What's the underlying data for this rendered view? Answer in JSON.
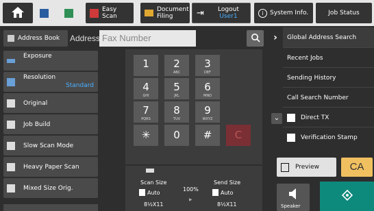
{
  "top_bar": {
    "easy_scan": "Easy Scan",
    "easy_scan_line1": "Easy",
    "easy_scan_line2": "Scan",
    "doc_filing_line1": "Document",
    "doc_filing_line2": "Filing",
    "logout_line1": "Logout",
    "logout_user": "User1",
    "system_info": "System Info.",
    "job_status": "Job Status"
  },
  "address": {
    "address_book": "Address Book",
    "address_label": "Address",
    "fax_placeholder": "Fax Number"
  },
  "left_items": [
    {
      "label": "Exposure",
      "value": ""
    },
    {
      "label": "Resolution",
      "value": "Standard"
    },
    {
      "label": "Original",
      "value": ""
    },
    {
      "label": "Job Build",
      "value": ""
    },
    {
      "label": "Slow Scan Mode",
      "value": ""
    },
    {
      "label": "Heavy Paper Scan",
      "value": ""
    },
    {
      "label": "Mixed Size Orig.",
      "value": ""
    }
  ],
  "keypad": [
    {
      "num": "1",
      "sub": ""
    },
    {
      "num": "2",
      "sub": "ABC"
    },
    {
      "num": "3",
      "sub": "DEF"
    },
    {
      "num": "4",
      "sub": "GHI"
    },
    {
      "num": "5",
      "sub": "JKL"
    },
    {
      "num": "6",
      "sub": "MNO"
    },
    {
      "num": "7",
      "sub": "PQRS"
    },
    {
      "num": "8",
      "sub": "TUV"
    },
    {
      "num": "9",
      "sub": "WXYZ"
    },
    {
      "num": "✳",
      "sub": ""
    },
    {
      "num": "0",
      "sub": ""
    },
    {
      "num": "#",
      "sub": ""
    },
    {
      "num": "C",
      "sub": ""
    }
  ],
  "size_bar": {
    "scan_size": "Scan Size",
    "scan_auto": "Auto",
    "scan_paper": "8½X11",
    "ratio": "100%",
    "send_size": "Send Size",
    "send_auto": "Auto",
    "send_paper": "8½X11"
  },
  "right_menu": {
    "global_search": "Global Address Search",
    "recent_jobs": "Recent Jobs",
    "sending_history": "Sending History",
    "call_search": "Call Search Number",
    "direct_tx": "Direct TX",
    "verification_stamp": "Verification Stamp"
  },
  "actions": {
    "preview": "Preview",
    "ca": "CA",
    "speaker": "Speaker"
  },
  "colors": {
    "accent_blue": "#4ab0ff",
    "start_teal": "#0e8a7c",
    "ca_yellow": "#f0c060"
  }
}
